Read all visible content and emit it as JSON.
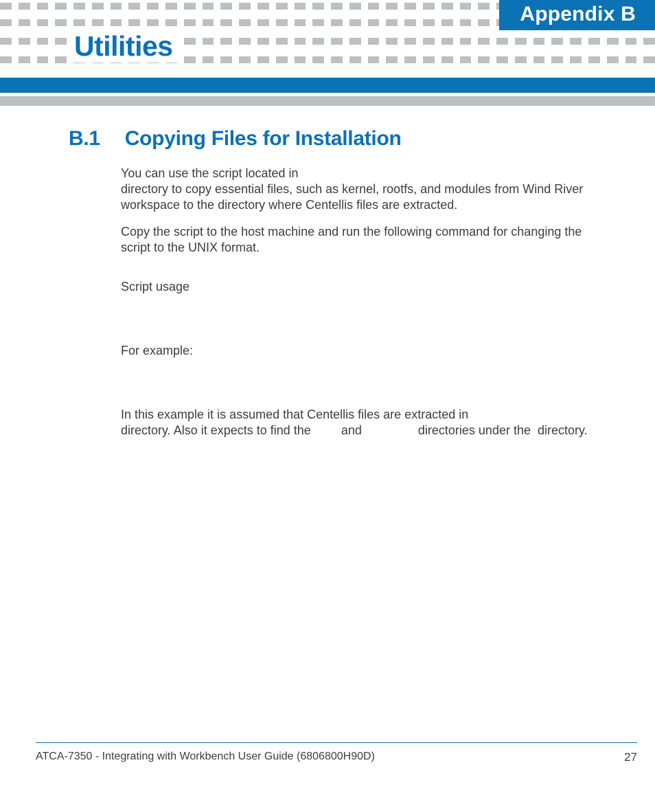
{
  "header": {
    "appendix_label": "Appendix B",
    "title": "Utilities"
  },
  "section": {
    "number": "B.1",
    "title": "Copying Files for Installation"
  },
  "paragraphs": {
    "p1_a": "You can use the script located in ",
    "p1_b": " directory to copy essential files, such as kernel, rootfs, and modules from Wind River workspace to the directory where Centellis files are extracted.",
    "p2": "Copy the script to the host machine and run the following command for changing the script to the UNIX format.",
    "p3": "Script usage",
    "p4": "For example:",
    "p5_a": "In this example it is assumed that Centellis files are extracted in ",
    "p5_b": " directory. Also it expects to find the ",
    "p5_c": " and ",
    "p5_d": " directories under the ",
    "p5_e": " directory."
  },
  "footer": {
    "doc_title": "ATCA-7350 - Integrating with Workbench User Guide (6806800H90D)",
    "page_number": "27"
  },
  "colors": {
    "accent": "#0a72b5",
    "grey": "#bcc0c3"
  }
}
